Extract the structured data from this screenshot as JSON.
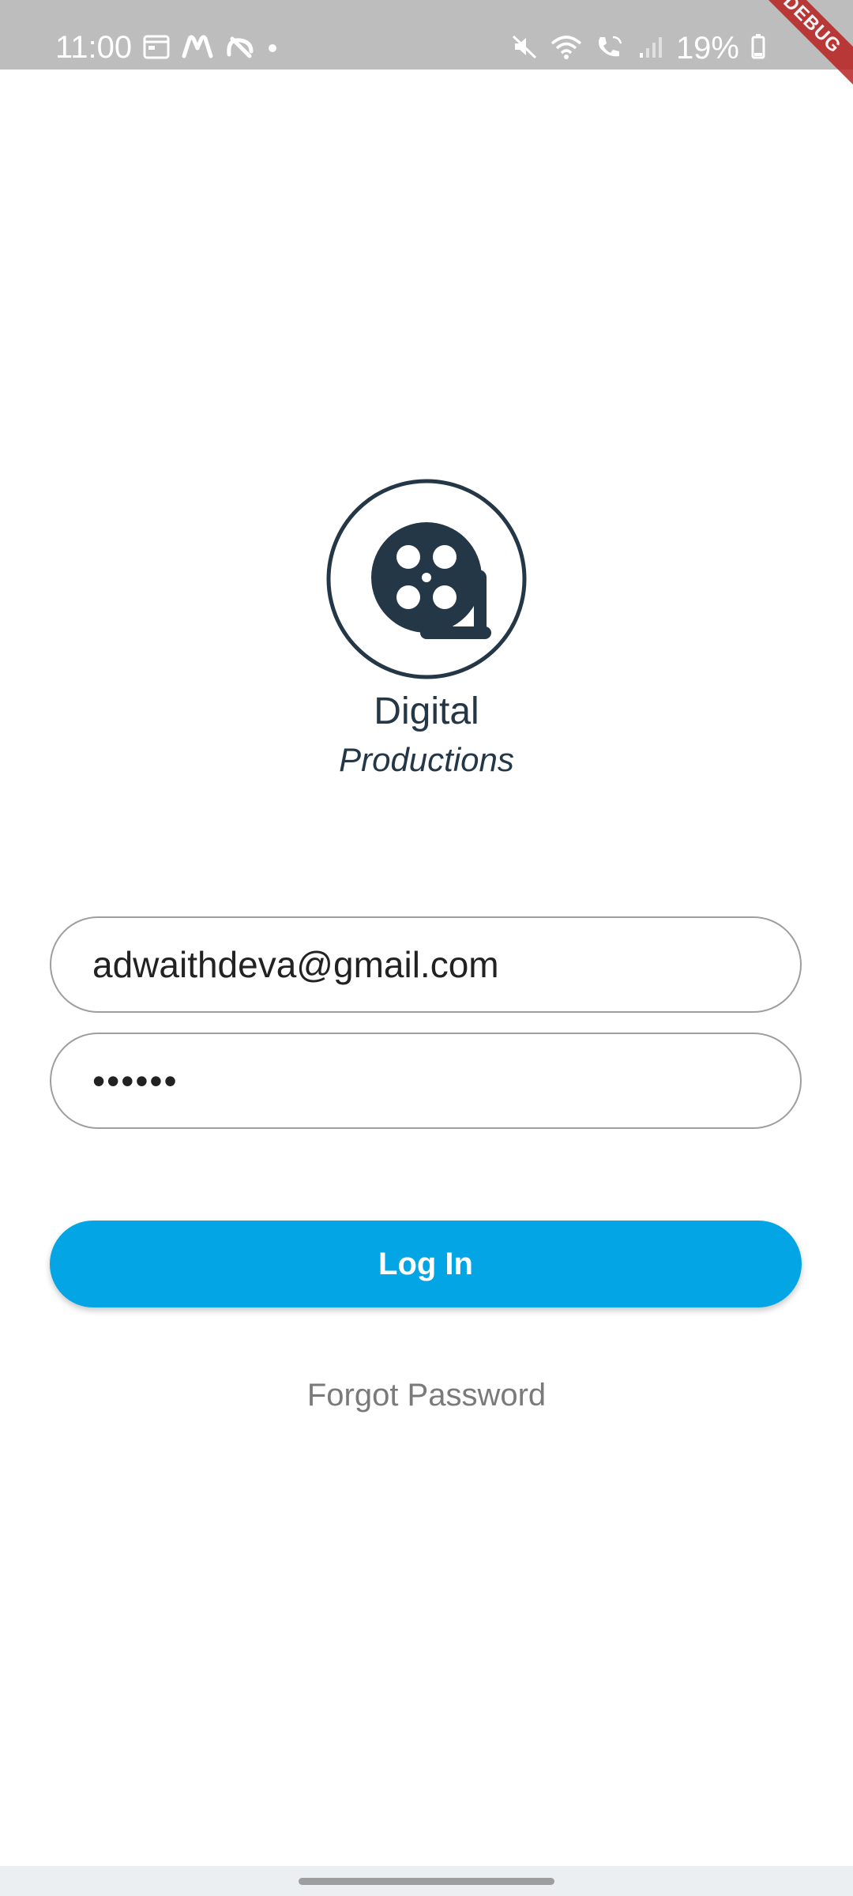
{
  "status_bar": {
    "time": "11:00",
    "battery": "19%",
    "left_icons": [
      "calendar-icon",
      "m-app-icon",
      "link-app-icon",
      "dot-icon"
    ],
    "right_icons": [
      "mute-icon",
      "wifi-icon",
      "wifi-call-icon",
      "signal-icon",
      "battery-icon"
    ],
    "debug_label": "DEBUG",
    "background_color": "#bdbdbd"
  },
  "brand": {
    "name": "Digital",
    "subtitle": "Productions",
    "icon": "film-reel-icon",
    "color": "#243747"
  },
  "login_form": {
    "email_value": "adwaithdeva@gmail.com",
    "password_value": "••••••",
    "login_label": "Log In",
    "forgot_label": "Forgot Password",
    "accent_color": "#03a5e4"
  }
}
